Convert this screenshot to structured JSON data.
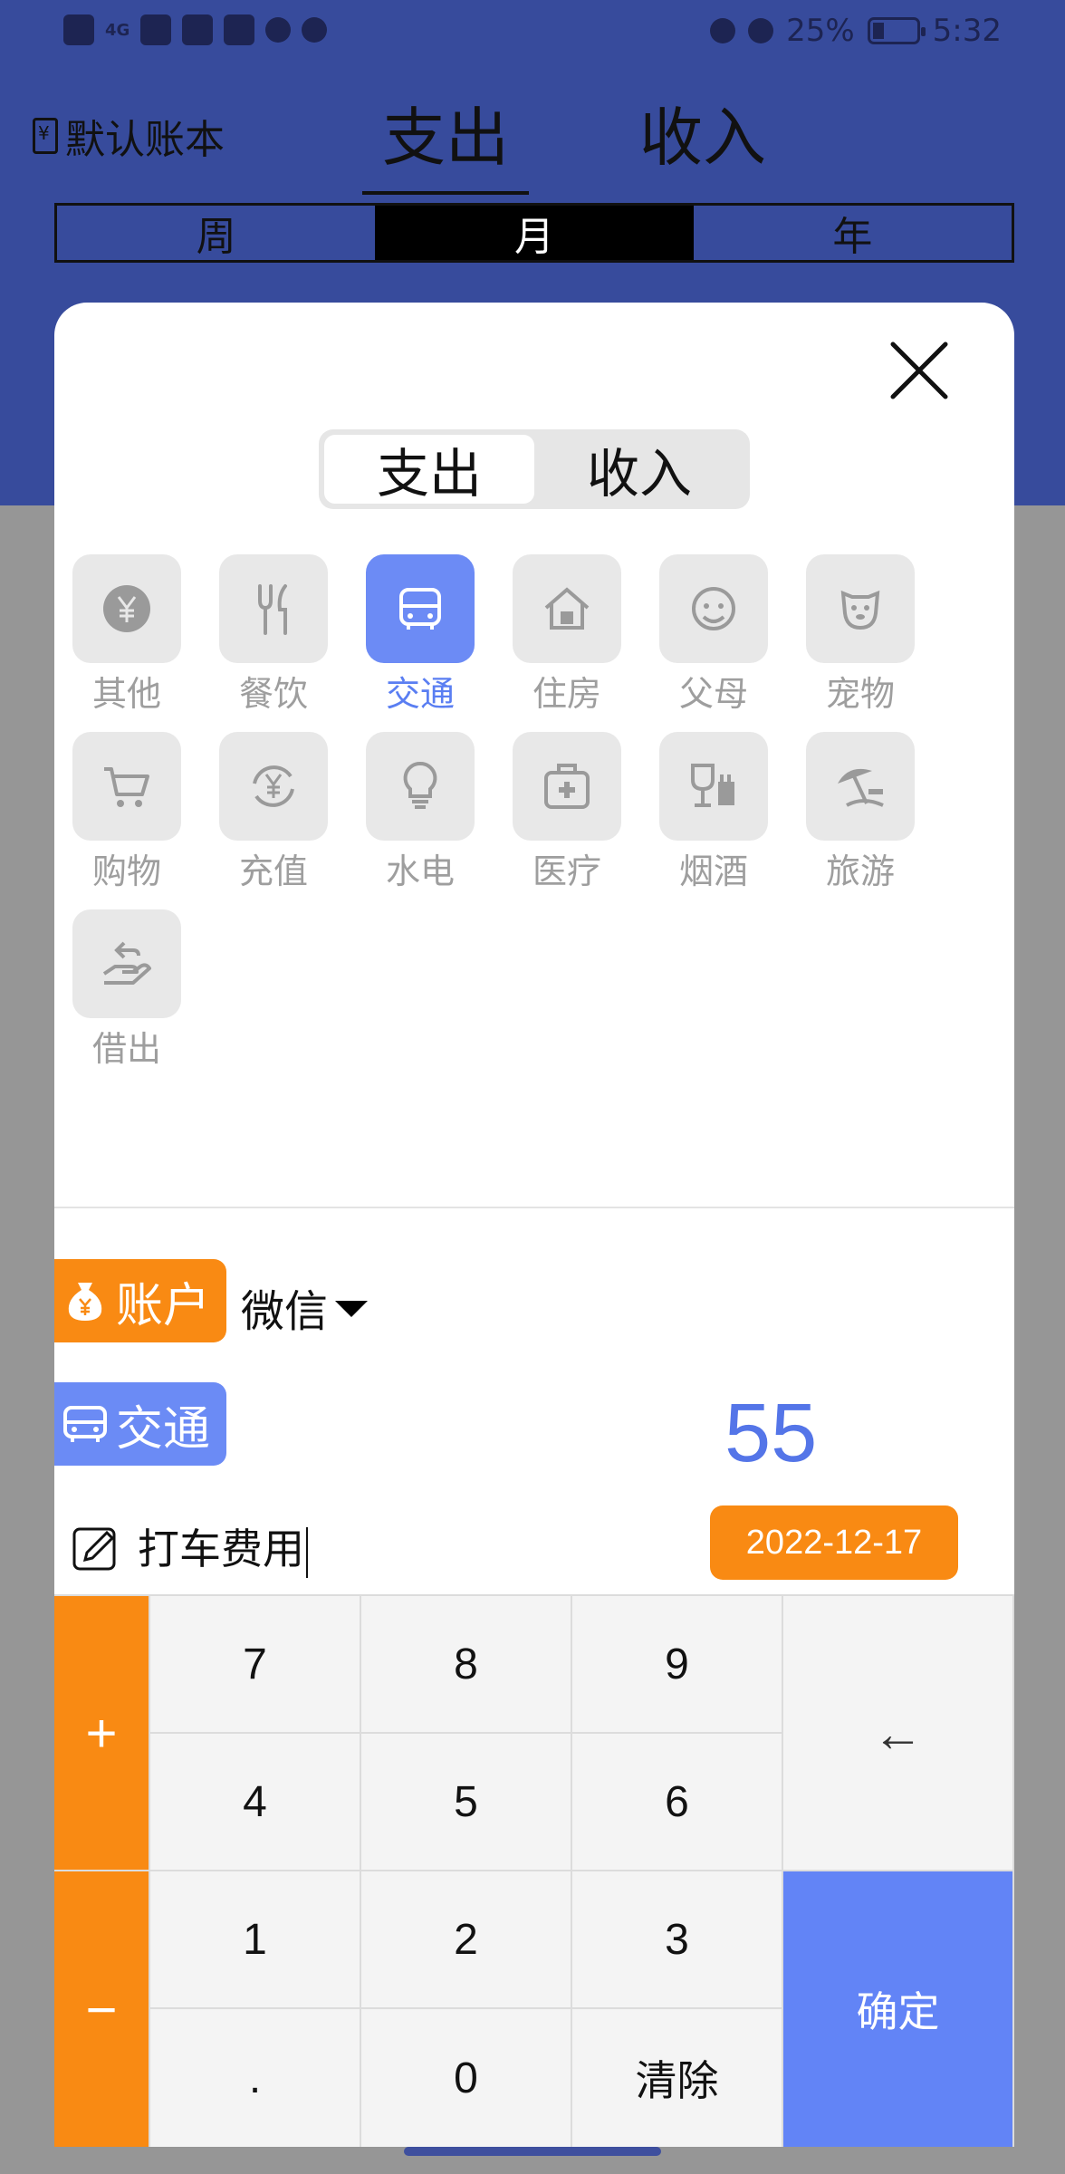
{
  "status_bar": {
    "battery": "25%",
    "time": "5:32",
    "network": "4G"
  },
  "header": {
    "book_label": "默认账本",
    "tabs": [
      {
        "label": "支出",
        "active": true
      },
      {
        "label": "收入",
        "active": false
      }
    ],
    "periods": [
      {
        "label": "周",
        "active": false
      },
      {
        "label": "月",
        "active": true
      },
      {
        "label": "年",
        "active": false
      }
    ]
  },
  "modal": {
    "segment": [
      {
        "label": "支出",
        "active": true
      },
      {
        "label": "收入",
        "active": false
      }
    ],
    "categories": [
      {
        "label": "其他",
        "icon": "yen-coin-icon"
      },
      {
        "label": "餐饮",
        "icon": "fork-knife-icon"
      },
      {
        "label": "交通",
        "icon": "bus-icon",
        "selected": true
      },
      {
        "label": "住房",
        "icon": "house-icon"
      },
      {
        "label": "父母",
        "icon": "elder-face-icon"
      },
      {
        "label": "宠物",
        "icon": "dog-face-icon"
      },
      {
        "label": "购物",
        "icon": "cart-icon"
      },
      {
        "label": "充值",
        "icon": "recharge-yen-icon"
      },
      {
        "label": "水电",
        "icon": "lightbulb-icon"
      },
      {
        "label": "医疗",
        "icon": "medical-kit-icon"
      },
      {
        "label": "烟酒",
        "icon": "wine-cigarette-icon"
      },
      {
        "label": "旅游",
        "icon": "beach-umbrella-icon"
      },
      {
        "label": "借出",
        "icon": "lend-hand-icon"
      }
    ],
    "account": {
      "chip_label": "账户",
      "value": "微信"
    },
    "category_chip": {
      "label": "交通"
    },
    "amount": "55",
    "note": "打车费用",
    "date": "2022-12-17",
    "colors": {
      "accent_blue": "#6b8bf5",
      "accent_orange": "#f98a13",
      "amount_blue": "#5475e8",
      "header_blue": "#374b9c"
    }
  },
  "keypad": {
    "plus": "+",
    "minus": "−",
    "keys": [
      "7",
      "8",
      "9",
      "4",
      "5",
      "6",
      "1",
      "2",
      "3",
      ".",
      "0"
    ],
    "clear": "清除",
    "backspace": "←",
    "confirm": "确定"
  }
}
